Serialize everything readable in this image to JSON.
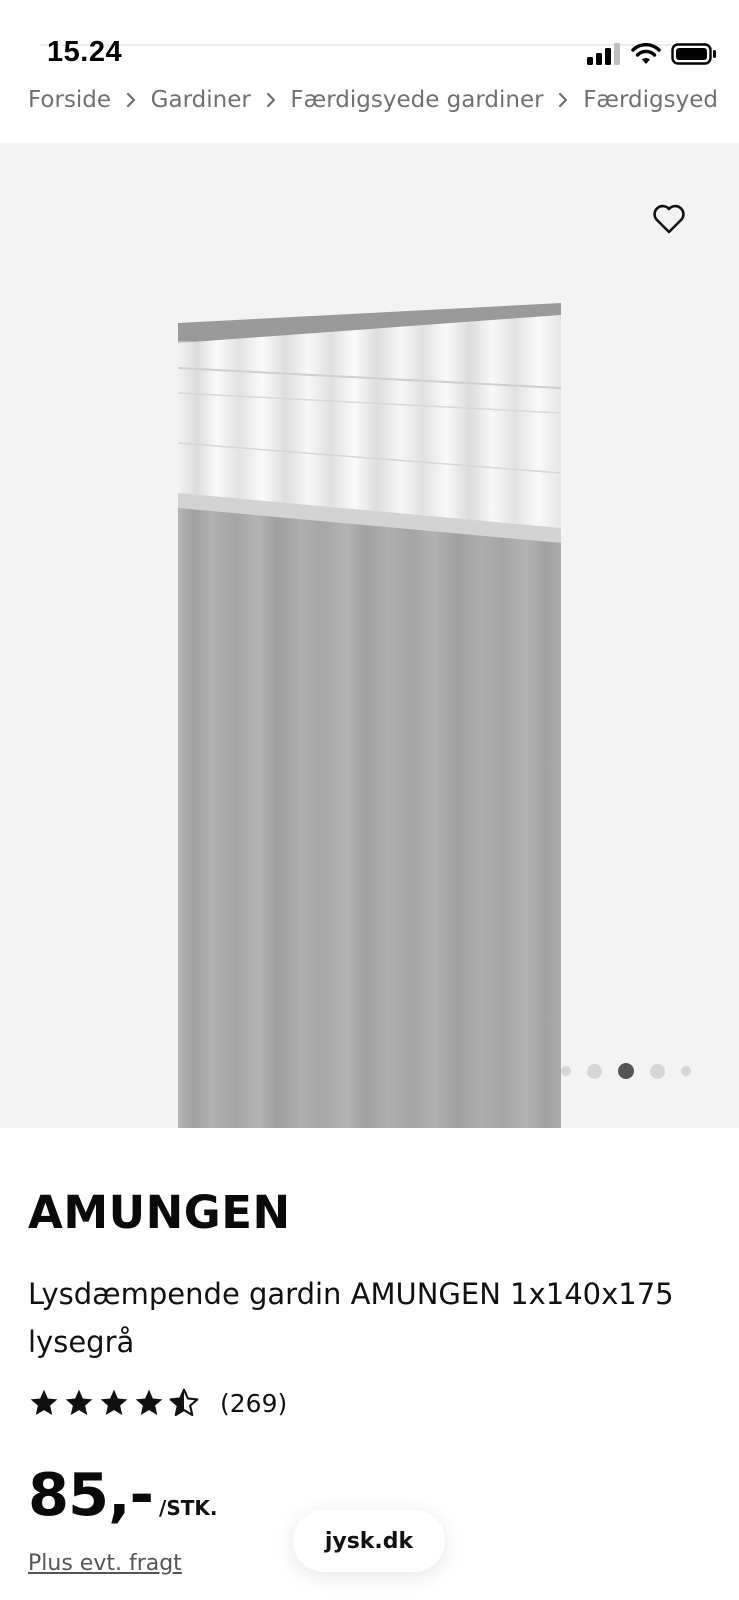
{
  "status_bar": {
    "time": "15.24",
    "icons": [
      "cellular-signal-icon",
      "wifi-icon",
      "battery-icon"
    ]
  },
  "breadcrumb": {
    "items": [
      "Forside",
      "Gardiner",
      "Færdigsyede gardiner",
      "Færdigsyed"
    ],
    "separator_icon": "chevron-right-icon"
  },
  "gallery": {
    "favorite_icon": "heart-icon",
    "dots_total": 5,
    "active_dot": 3,
    "image_subject": "light grey curtain with white header tape"
  },
  "product": {
    "name": "AMUNGEN",
    "description": "Lysdæmpende gardin AMUNGEN 1x140x175 lysegrå",
    "rating": 4.5,
    "rating_max": 5,
    "review_count": "(269)",
    "price": "85,-",
    "unit": "/STK.",
    "shipping_note": "Plus evt. fragt"
  },
  "browser": {
    "domain": "jysk.dk"
  },
  "colors": {
    "gallery_bg": "#f3f3f3",
    "curtain_grey": "#a9a9a9",
    "text": "#111111",
    "muted": "#707070"
  }
}
